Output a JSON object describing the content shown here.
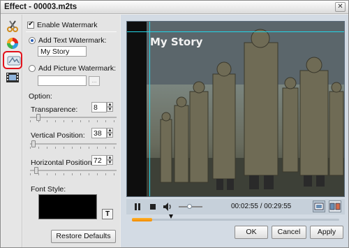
{
  "window": {
    "title": "Effect - 00003.m2ts",
    "close_label": "✕"
  },
  "tools": [
    {
      "name": "trim-tool-icon",
      "selected": false
    },
    {
      "name": "color-wheel-icon",
      "selected": false
    },
    {
      "name": "watermark-tool-icon",
      "selected": true
    },
    {
      "name": "film-clip-icon",
      "selected": false
    }
  ],
  "panel": {
    "enable_label": "Enable Watermark",
    "enable_checked": true,
    "text_wm_label": "Add Text Watermark:",
    "text_wm_value": "My Story",
    "picture_wm_label": "Add Picture Watermark:",
    "picture_wm_value": "",
    "browse_label": "...",
    "option_label": "Option:",
    "transparence_label": "Transparence:",
    "transparence_value": "8",
    "transparence_level": 0.08,
    "vertical_label": "Vertical Position:",
    "vertical_value": "38",
    "vertical_level": 0.02,
    "horizontal_label": "Horizontal Position:",
    "horizontal_value": "72",
    "horizontal_level": 0.05,
    "font_style_label": "Font Style:",
    "font_button": "T",
    "restore_label": "Restore Defaults"
  },
  "preview": {
    "watermark_text": "My Story",
    "guide_color": "#23d6e8"
  },
  "player": {
    "time_current": "00:02:55",
    "time_separator": "/",
    "time_total": "00:29:55",
    "volume_level": 0.45,
    "progress": 0.097
  },
  "buttons": {
    "ok": "OK",
    "cancel": "Cancel",
    "apply": "Apply"
  },
  "colors": {
    "accent_progress": "#f28a00",
    "selection_outline": "#e3121b",
    "preview_bg": "#0e0e0e"
  }
}
